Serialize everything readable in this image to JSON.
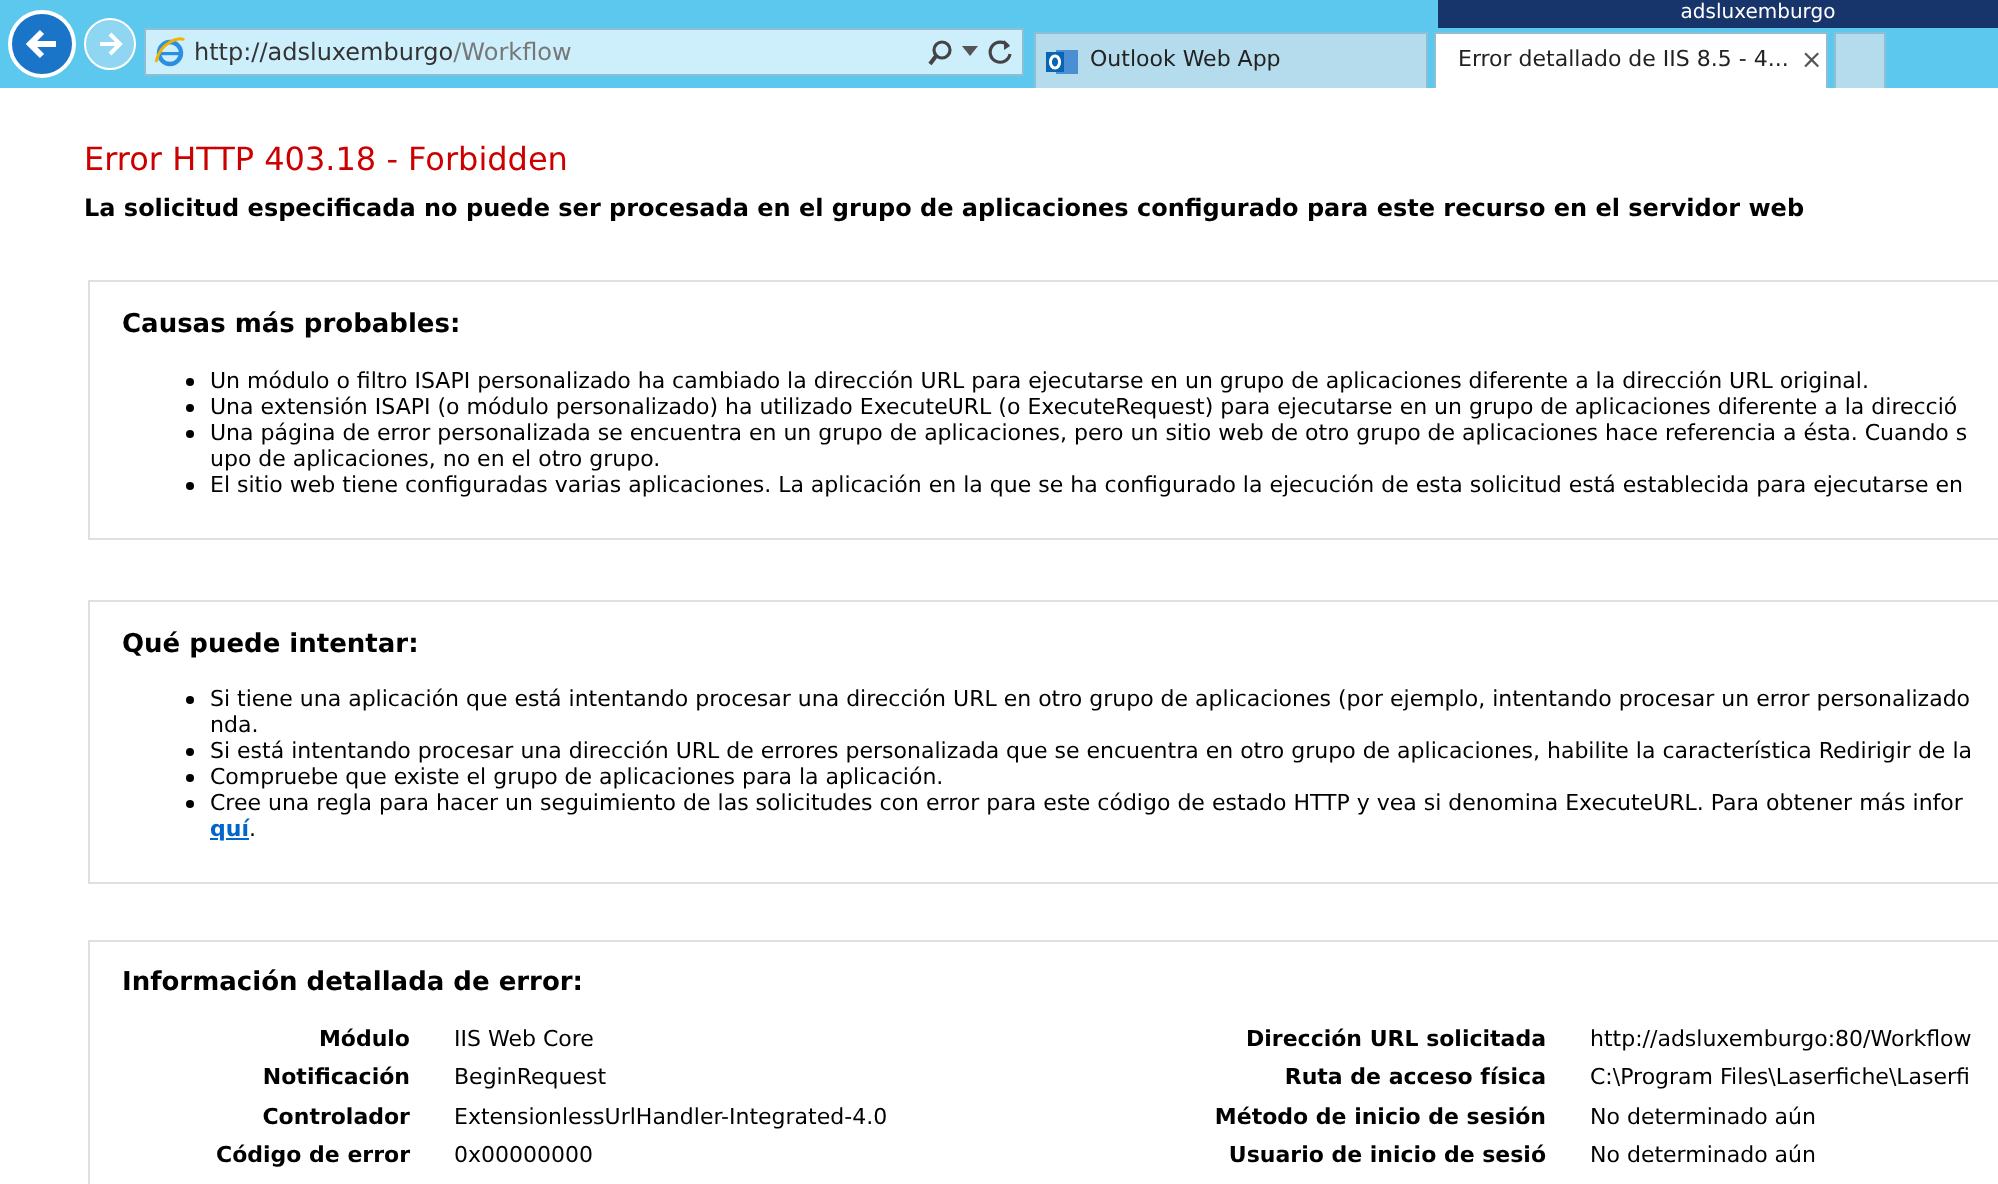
{
  "taskbar": {
    "user": "adsluxemburgo"
  },
  "browser": {
    "address": {
      "value_host": "http://adsluxemburgo",
      "value_path": "/Workflow"
    },
    "tabs": [
      {
        "label": "Outlook Web App",
        "selected": false,
        "kind": "outlook"
      },
      {
        "label": "Error detallado de IIS 8.5 - 4...",
        "selected": true,
        "kind": "ie",
        "close": "×"
      }
    ]
  },
  "page": {
    "title": "Error HTTP 403.18 - Forbidden",
    "subtitle": "La solicitud especificada no puede ser procesada en el grupo de aplicaciones configurado para este recurso en el servidor web",
    "sections": [
      {
        "heading": "Causas más probables:",
        "items": [
          [
            [
              {
                "kind": "text",
                "text": "Un módulo o filtro ISAPI personalizado ha cambiado la dirección URL para ejecutarse en un grupo de aplicaciones diferente a la dirección URL original."
              }
            ]
          ],
          [
            [
              {
                "kind": "text",
                "text": "Una extensión ISAPI (o módulo personalizado) ha utilizado ExecuteURL (o ExecuteRequest) para ejecutarse en un grupo de aplicaciones diferente a la direcció"
              }
            ]
          ],
          [
            [
              {
                "kind": "text",
                "text": "Una página de error personalizada se encuentra en un grupo de aplicaciones, pero un sitio web de otro grupo de aplicaciones hace referencia a ésta. Cuando s"
              }
            ],
            [
              {
                "kind": "text",
                "text": "upo de aplicaciones, no en el otro grupo."
              }
            ]
          ],
          [
            [
              {
                "kind": "text",
                "text": "El sitio web tiene configuradas varias aplicaciones. La aplicación en la que se ha configurado la ejecución de esta solicitud está establecida para ejecutarse en"
              }
            ]
          ]
        ]
      },
      {
        "heading": "Qué puede intentar:",
        "items": [
          [
            [
              {
                "kind": "text",
                "text": "Si tiene una aplicación que está intentando procesar una dirección URL en otro grupo de aplicaciones (por ejemplo, intentando procesar un error personalizado"
              }
            ],
            [
              {
                "kind": "text",
                "text": "nda."
              }
            ]
          ],
          [
            [
              {
                "kind": "text",
                "text": "Si está intentando procesar una dirección URL de errores personalizada que se encuentra en otro grupo de aplicaciones, habilite la característica Redirigir de la"
              }
            ]
          ],
          [
            [
              {
                "kind": "text",
                "text": "Compruebe que existe el grupo de aplicaciones para la aplicación."
              }
            ]
          ],
          [
            [
              {
                "kind": "text",
                "text": "Cree una regla para hacer un seguimiento de las solicitudes con error para este código de estado HTTP y vea si denomina ExecuteURL. Para obtener más infor"
              }
            ],
            [
              {
                "kind": "link",
                "text": "quí"
              },
              {
                "kind": "text",
                "text": "."
              }
            ]
          ]
        ]
      }
    ],
    "details": {
      "heading": "Información detallada de error:",
      "left": [
        {
          "label": "Módulo",
          "value": "IIS Web Core"
        },
        {
          "label": "Notificación",
          "value": "BeginRequest"
        },
        {
          "label": "Controlador",
          "value": "ExtensionlessUrlHandler-Integrated-4.0"
        },
        {
          "label": "Código de error",
          "value": "0x00000000"
        }
      ],
      "right": [
        {
          "label": "Dirección URL solicitada",
          "value": "http://adsluxemburgo:80/Workflow"
        },
        {
          "label": "Ruta de acceso física",
          "value": "C:\\Program Files\\Laserfiche\\Laserfi"
        },
        {
          "label": "Método de inicio de sesión",
          "value": "No determinado aún"
        },
        {
          "label": "Usuario de inicio de sesió",
          "value": "No determinado aún"
        }
      ]
    }
  }
}
